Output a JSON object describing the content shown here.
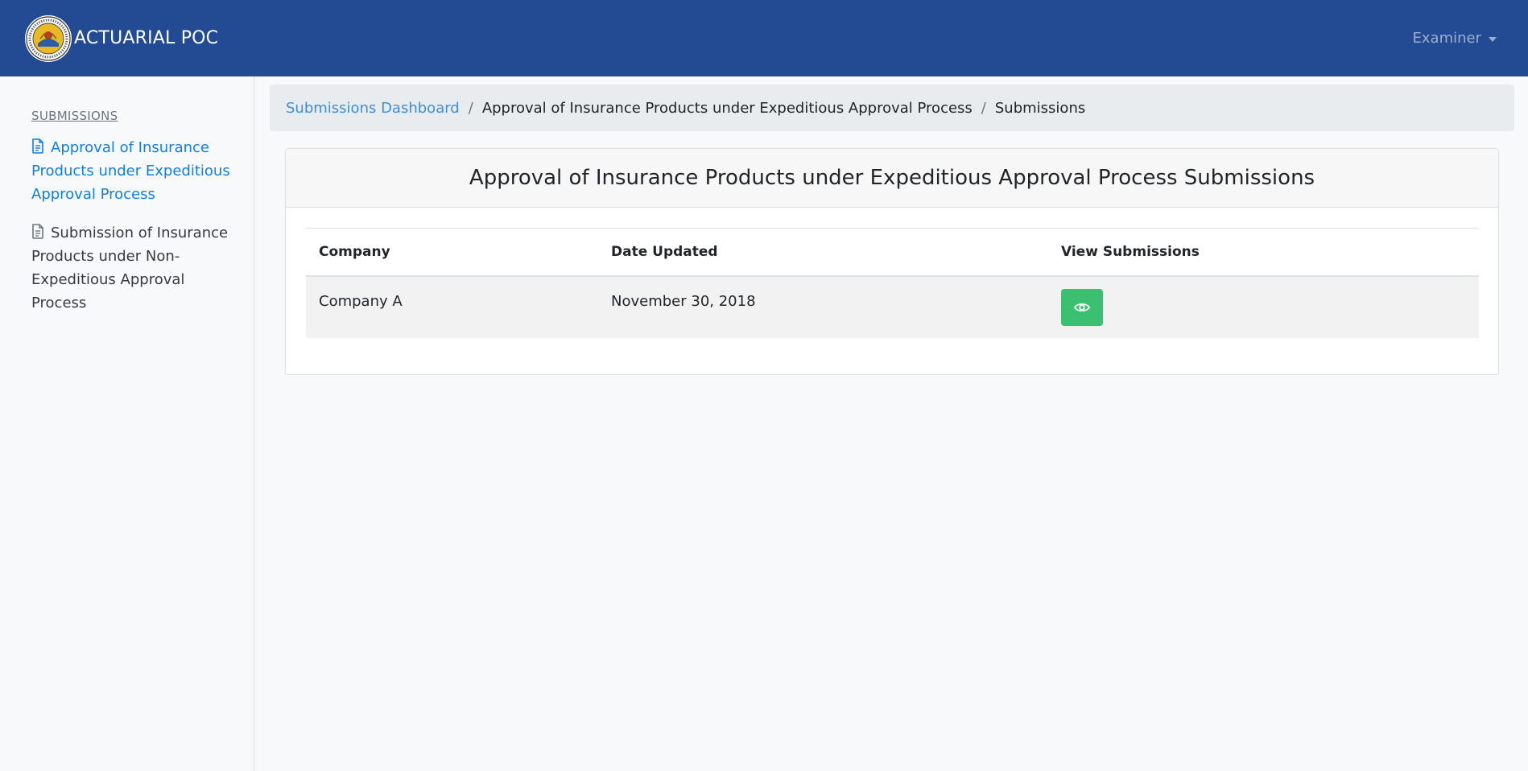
{
  "app": {
    "brand": "ACTUARIAL POC",
    "user_menu": "Examiner",
    "brand_color": "#234b94"
  },
  "sidebar": {
    "heading": "SUBMISSIONS",
    "items": [
      {
        "label": "Approval of Insurance Products under Expeditious Approval Process",
        "icon": "document-icon",
        "active": true
      },
      {
        "label": "Submission of Insurance Products under Non-Expeditious Approval Process",
        "icon": "document-icon",
        "active": false
      }
    ]
  },
  "breadcrumb": {
    "items": [
      "Submissions Dashboard",
      "Approval of Insurance Products under Expeditious Approval Process",
      "Submissions"
    ]
  },
  "card": {
    "title": "Approval of Insurance Products under Expeditious Approval Process Submissions",
    "table": {
      "columns": [
        "Company",
        "Date Updated",
        "View Submissions"
      ],
      "rows": [
        {
          "company": "Company A",
          "date_updated": "November 30, 2018",
          "action_icon": "eye-icon"
        }
      ]
    }
  },
  "colors": {
    "link": "#0f7ee6",
    "view_button": "#3bbf71"
  }
}
